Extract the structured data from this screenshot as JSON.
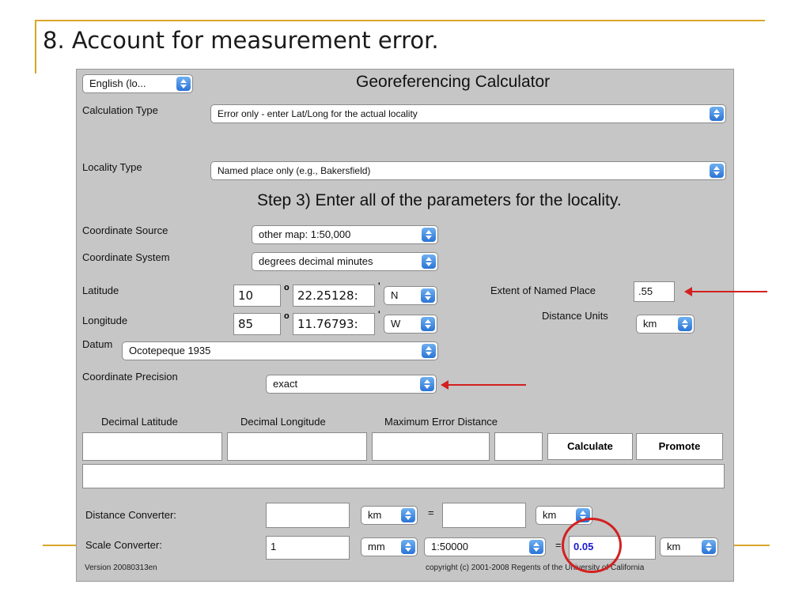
{
  "slide": {
    "title": "8. Account for measurement error."
  },
  "app": {
    "language_value": "English (lo...",
    "title": "Georeferencing Calculator",
    "calculation_type_label": "Calculation Type",
    "calculation_type_value": "Error only - enter Lat/Long for the actual locality",
    "locality_type_label": "Locality Type",
    "locality_type_value": "Named place only (e.g., Bakersfield)",
    "step_heading": "Step 3) Enter all of the parameters for the locality.",
    "coordinate_source_label": "Coordinate Source",
    "coordinate_source_value": "other map: 1:50,000",
    "coordinate_system_label": "Coordinate System",
    "coordinate_system_value": "degrees decimal minutes",
    "latitude_label": "Latitude",
    "latitude_degrees": "10",
    "latitude_minutes": "22.25128:",
    "latitude_direction": "N",
    "longitude_label": "Longitude",
    "longitude_degrees": "85",
    "longitude_minutes": "11.76793:",
    "longitude_direction": "W",
    "degree_symbol": "o",
    "minute_symbol": "'",
    "extent_label": "Extent of Named Place",
    "extent_value": ".55",
    "distance_units_label": "Distance Units",
    "distance_units_value": "km",
    "datum_label": "Datum",
    "datum_value": "Ocotepeque 1935",
    "coordinate_precision_label": "Coordinate Precision",
    "coordinate_precision_value": "exact",
    "decimal_latitude_header": "Decimal Latitude",
    "decimal_longitude_header": "Decimal Longitude",
    "max_error_header": "Maximum Error Distance",
    "calculate_label": "Calculate",
    "promote_label": "Promote",
    "distance_converter_label": "Distance Converter:",
    "distance_from_unit": "km",
    "equals": "=",
    "distance_to_unit": "km",
    "scale_converter_label": "Scale Converter:",
    "scale_input_value": "1",
    "scale_input_unit": "mm",
    "scale_ratio": "1:50000",
    "scale_result": "0.05",
    "scale_result_unit": "km",
    "version": "Version 20080313en",
    "copyright": "copyright (c) 2001-2008 Regents of the University of California"
  },
  "colors": {
    "accent_line": "#d9a62a",
    "annotation_red": "#d32020",
    "result_blue": "#1a1acc",
    "panel_gray": "#c6c6c6"
  }
}
